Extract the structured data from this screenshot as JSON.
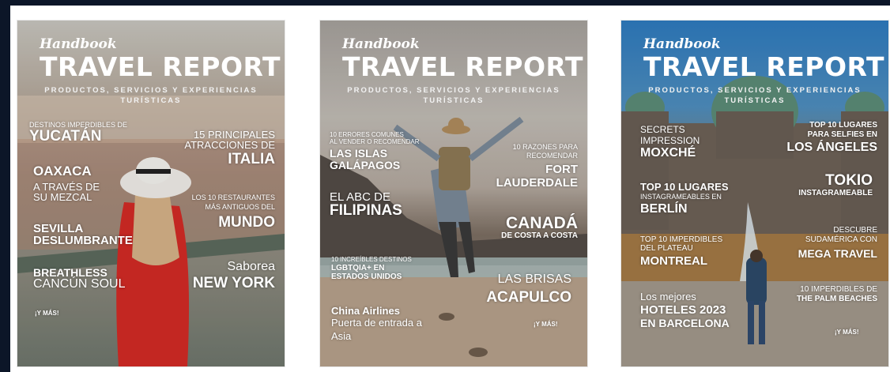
{
  "covers": [
    {
      "handbook": "Handbook",
      "title": "TRAVEL REPORT",
      "subtitle": "PRODUCTOS, SERVICIOS Y EXPERIENCIAS TURÍSTICAS",
      "items": [
        "DESTINOS IMPERDIBLES DE",
        "YUCATÁN",
        "15 PRINCIPALES",
        "ATRACCIONES DE",
        "ITALIA",
        "OAXACA",
        "A TRAVÉS DE",
        "SU MEZCAL",
        "LOS 10 RESTAURANTES",
        "MÁS ANTIGUOS DEL",
        "MUNDO",
        "SEVILLA",
        "DESLUMBRANTE",
        "Saborea",
        "NEW YORK",
        "BREATHLESS",
        "CANCÚN SOUL",
        "¡Y MÁS!"
      ]
    },
    {
      "handbook": "Handbook",
      "title": "TRAVEL REPORT",
      "subtitle": "PRODUCTOS, SERVICIOS Y EXPERIENCIAS TURÍSTICAS",
      "items": [
        "10 ERRORES COMUNES",
        "AL VENDER O RECOMENDAR",
        "LAS ISLAS",
        "GALÁPAGOS",
        "10 RAZONES PARA",
        "RECOMENDAR",
        "FORT",
        "LAUDERDALE",
        "EL ABC DE",
        "FILIPINAS",
        "CANADÁ",
        "DE COSTA A COSTA",
        "10 INCREÍBLES DESTINOS",
        "LGBTQIA+ EN",
        "ESTADOS UNIDOS",
        "LAS BRISAS",
        "ACAPULCO",
        "China Airlines",
        "Puerta de entrada a",
        "Asia",
        "¡Y MÁS!"
      ]
    },
    {
      "handbook": "Handbook",
      "title": "TRAVEL REPORT",
      "subtitle": "PRODUCTOS, SERVICIOS Y EXPERIENCIAS TURÍSTICAS",
      "items": [
        "SECRETS",
        "IMPRESSION",
        "MOXCHÉ",
        "TOP 10 LUGARES",
        "PARA SELFIES EN",
        "LOS ÁNGELES",
        "TOP 10 LUGARES",
        "INSTAGRAMEABLES EN",
        "BERLÍN",
        "TOKIO",
        "INSTAGRAMEABLE",
        "TOP 10 IMPERDIBLES",
        "DEL PLATEAU",
        "MONTREAL",
        "DESCUBRE",
        "SUDAMÉRICA CON",
        "MEGA TRAVEL",
        "Los mejores",
        "HOTELES 2023",
        "EN BARCELONA",
        "10 IMPERDIBLES DE",
        "THE PALM BEACHES",
        "¡Y MÁS!"
      ]
    }
  ]
}
